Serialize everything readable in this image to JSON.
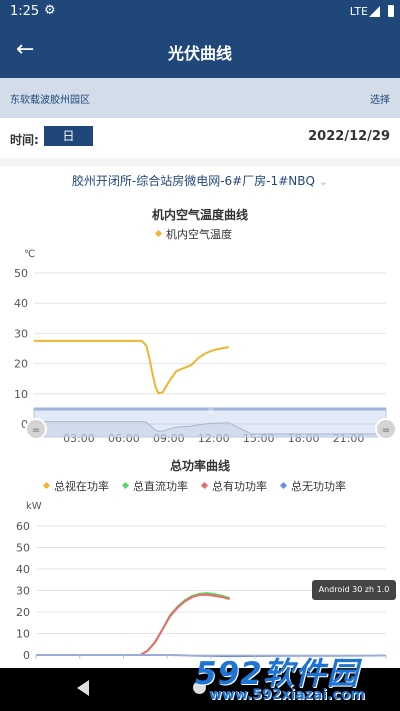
{
  "status_bar": {
    "time": "1:25",
    "network": "LTE"
  },
  "app_bar": {
    "title": "光伏曲线"
  },
  "site_bar": {
    "site_name": "东软载波胶州园区",
    "select_label": "选择"
  },
  "time_row": {
    "label": "时间:",
    "period": "日",
    "date": "2022/12/29"
  },
  "device": {
    "name": "胶州开闭所-综合站房微电网-6#厂房-1#NBQ"
  },
  "colors": {
    "primary": "#1f477a",
    "temp_line": "#f0b432"
  },
  "icons": {
    "back": "arrow-left-icon",
    "settings": "gear-icon",
    "dropdown": "chevron-down-icon"
  },
  "chart_data": [
    {
      "type": "line",
      "title": "机内空气温度曲线",
      "ylabel": "℃",
      "ylim": [
        0,
        50
      ],
      "yticks": [
        0,
        10,
        20,
        30,
        40,
        50
      ],
      "xtick_labels": [
        "03:00",
        "06:00",
        "09:00",
        "12:00",
        "15:00",
        "18:00",
        "21:00"
      ],
      "xlim": [
        0,
        23.5
      ],
      "grid": true,
      "legend": "top",
      "series": [
        {
          "name": "机内空气温度",
          "color": "#f0b432",
          "x": [
            0,
            2,
            4,
            6,
            7.2,
            7.5,
            7.7,
            7.9,
            8.1,
            8.3,
            8.6,
            9.0,
            9.5,
            10.0,
            10.5,
            11.0,
            11.5,
            12.0,
            13.0
          ],
          "y": [
            27.5,
            27.5,
            27.5,
            27.5,
            27.5,
            26,
            22,
            17,
            12.5,
            10.2,
            10.5,
            14,
            17.5,
            18.5,
            19.5,
            22,
            23.5,
            24.5,
            25.5
          ]
        }
      ],
      "zoom_slider": {
        "start": 0,
        "end": 100
      }
    },
    {
      "type": "line",
      "title": "总功率曲线",
      "ylabel": "kW",
      "ylim": [
        0,
        60
      ],
      "yticks": [
        0,
        10,
        20,
        30,
        40,
        50,
        60
      ],
      "xlim": [
        0,
        23.5
      ],
      "grid": true,
      "legend": "top",
      "series": [
        {
          "name": "总视在功率",
          "color": "#f0b432",
          "x": [
            0,
            7,
            7.5,
            8,
            8.5,
            9,
            9.5,
            10,
            10.5,
            11,
            11.5,
            12,
            12.5,
            13
          ],
          "y": [
            0,
            0,
            2,
            6,
            12,
            18,
            22,
            25,
            27,
            28,
            28,
            27.5,
            27,
            26
          ]
        },
        {
          "name": "总直流功率",
          "color": "#5ad66a",
          "x": [
            0,
            7,
            7.5,
            8,
            8.5,
            9,
            9.5,
            10,
            10.5,
            11,
            11.5,
            12,
            12.5,
            13
          ],
          "y": [
            0,
            0,
            2,
            6,
            12,
            18.5,
            22.5,
            25.5,
            27.5,
            28.5,
            28.8,
            28.3,
            27.5,
            26.5
          ]
        },
        {
          "name": "总有功功率",
          "color": "#e86c6c",
          "x": [
            0,
            7,
            7.5,
            8,
            8.5,
            9,
            9.5,
            10,
            10.5,
            11,
            11.5,
            12,
            12.5,
            13
          ],
          "y": [
            0,
            0,
            2,
            6,
            12,
            18,
            22,
            25,
            27,
            28,
            28,
            27.5,
            27,
            26
          ]
        },
        {
          "name": "总无功功率",
          "color": "#6a8ee8",
          "x": [
            0,
            7,
            9,
            11,
            13,
            15,
            17,
            20,
            23.5
          ],
          "y": [
            0,
            0,
            0,
            -0.3,
            -0.5,
            -0.4,
            -0.3,
            -0.3,
            -0.2
          ]
        }
      ]
    }
  ],
  "overlay": {
    "build_tag": "Android 30 zh 1.0"
  },
  "watermark": {
    "brand": "592软件园",
    "url": "www.592xiazai.com"
  }
}
